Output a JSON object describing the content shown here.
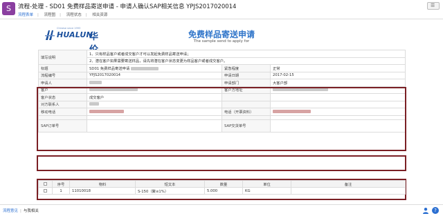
{
  "window": {
    "title": "流程-处理 - SD01 免费样品寄送申请 - 申请人确认SAP相关信息 YPJS2017020014",
    "tabs": [
      "流程表单",
      "流程图",
      "流程状态",
      "相关资源"
    ],
    "active_tab": 0,
    "brand_color": "#8a3fa0"
  },
  "form": {
    "company_name": "HUALUN",
    "company_cn": "华伦",
    "company_small": "Chinese since 1993",
    "title": "免费样品寄送申请",
    "subtitle": "The sample send to apply for",
    "fields": {
      "notes_label": "填写说明",
      "notes_line1": "1、只有样品客户或者成交客户才可以发起免费样品寄送申请；",
      "notes_line2": "2、潜在客户如果需要寄送样品，请先将潜在客户状态变更为样品客户或者成交客户。",
      "title_label": "标题",
      "title_value": "SD01 免费样品寄送申请",
      "urgency_label": "紧急程度",
      "urgency_value": "正常",
      "flow_no_label": "流程编号",
      "flow_no_value": "YPJS2017020014",
      "apply_date_label": "申请日期",
      "apply_date_value": "2017-02-15",
      "applicant_label": "申请人",
      "department_label": "申请部门",
      "department_value": "大客户部",
      "customer_label": "客户",
      "delivery_address_label": "客户方地址",
      "customer_status_label": "客户状态",
      "customer_status_value": "成交客户",
      "contact_label": "对方联系人",
      "mobile_label": "移动电话",
      "phone_label": "电话（开票资料）",
      "sap_order_label": "SAP订单号",
      "sap_delivery_label": "SAP交货单号"
    },
    "accent_color": "#2e74c9",
    "highlight_color": "#7a1f24"
  },
  "items": {
    "headers": [
      "序号",
      "物料",
      "短文本",
      "数量",
      "单位",
      "备注"
    ],
    "rows": [
      {
        "no": "1",
        "material": "11010018",
        "short_text": "S-150（聚≤1%）",
        "qty": "5.000",
        "unit": "KG",
        "remark": ""
      }
    ]
  },
  "bottom": {
    "links": [
      "流程意见",
      "与我相关"
    ]
  }
}
